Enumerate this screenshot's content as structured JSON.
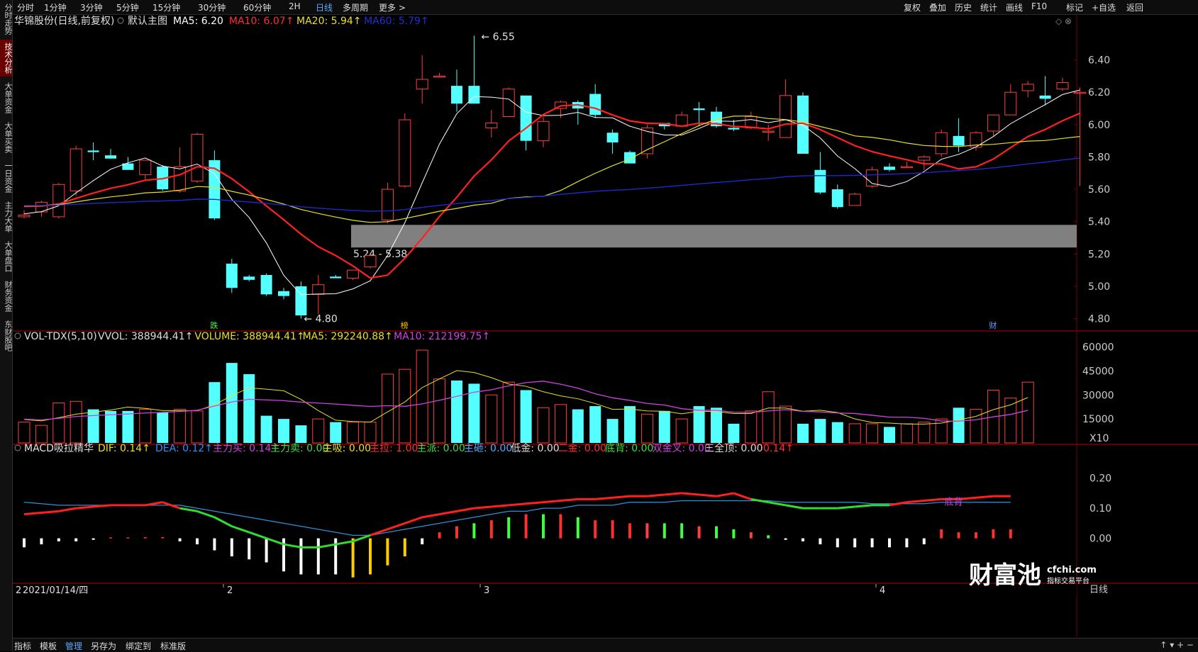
{
  "sidebar": {
    "tabs": [
      "分时走势",
      "技术分析",
      "大单资金",
      "大单买卖",
      "一日资金",
      "主力大单",
      "大单盘口",
      "财务资金",
      "东财股吧"
    ],
    "active_index": 1
  },
  "topbar": {
    "periods": [
      "分时",
      "1分钟",
      "3分钟",
      "5分钟",
      "15分钟",
      "30分钟",
      "60分钟",
      "2H",
      "日线",
      "多周期",
      "更多 >"
    ],
    "active_period": "日线",
    "right_items": [
      "复权",
      "叠加",
      "历史",
      "统计",
      "画线",
      "F10",
      "标记",
      "+自选",
      "返回"
    ]
  },
  "main": {
    "title": "华锦股份(日线,前复权)",
    "subtitle": "默认主图",
    "ma": [
      {
        "label": "MA5: 6.20",
        "color": "#ffffff"
      },
      {
        "label": "MA10: 6.07↑",
        "color": "#ff3030"
      },
      {
        "label": "MA20: 5.94↑",
        "color": "#e8e020"
      },
      {
        "label": "MA60: 5.79↑",
        "color": "#2030d0"
      }
    ],
    "price_axis": [
      "6.40",
      "6.20",
      "6.00",
      "5.80",
      "5.60",
      "5.40",
      "5.20",
      "5.00",
      "4.80"
    ],
    "high_label": "6.55",
    "low_label": "4.80",
    "zone_label": "5.24 - 5.38",
    "markers": [
      {
        "text": "跌",
        "color": "#40ff40"
      },
      {
        "text": "榜",
        "color": "#ffcc00"
      },
      {
        "text": "财",
        "color": "#60a0ff"
      }
    ]
  },
  "volume": {
    "title": "VOL-TDX(5,10)",
    "items": [
      {
        "label": "VVOL: 388944.41↑",
        "color": "#dddddd"
      },
      {
        "label": "VOLUME: 388944.41↑",
        "color": "#e8e020"
      },
      {
        "label": "MA5: 292240.88↑",
        "color": "#e8e020"
      },
      {
        "label": "MA10: 212199.75↑",
        "color": "#cc44dd"
      }
    ],
    "axis": [
      "60000",
      "45000",
      "30000",
      "15000",
      "X10"
    ]
  },
  "macd": {
    "title": "MACD吸拉精华",
    "items": [
      {
        "label": "DIF: 0.14↑",
        "color": "#e8e020"
      },
      {
        "label": "DEA: 0.12↑",
        "color": "#3090ff"
      },
      {
        "label": "主力买: 0.14↑",
        "color": "#cc44dd"
      },
      {
        "label": "主力卖: 0.00",
        "color": "#40dd40"
      },
      {
        "label": "主吸: 0.00",
        "color": "#e8e020"
      },
      {
        "label": "主拉: 1.00",
        "color": "#ff3030"
      },
      {
        "label": "主派: 0.00",
        "color": "#40dd40"
      },
      {
        "label": "主砸: 0.00",
        "color": "#5aa9ff"
      },
      {
        "label": "低金: 0.00",
        "color": "#dddddd"
      },
      {
        "label": "二金: 0.00",
        "color": "#ff3030"
      },
      {
        "label": "底背: 0.00",
        "color": "#40dd40"
      },
      {
        "label": "双金叉: 0.00",
        "color": "#cc44dd"
      },
      {
        "label": "三全顶: 0.00",
        "color": "#dddddd"
      },
      {
        "label": ": 0.14↑",
        "color": "#ff3030"
      }
    ],
    "axis": [
      "0.20",
      "0.10",
      "0.00"
    ],
    "divergence_label": "底背"
  },
  "xaxis": {
    "date": "2021/01/14/四",
    "prefix": "2",
    "months": [
      "2",
      "3",
      "4"
    ],
    "right_label": "日线"
  },
  "watermark": {
    "brand": "财富池",
    "domain": "cfchi.com",
    "tagline": "指标交易平台"
  },
  "bottombar": {
    "items": [
      "指标",
      "模板",
      "管理",
      "另存为",
      "绑定到",
      "标准版"
    ],
    "active": "管理"
  },
  "chart_data": {
    "type": "candlestick",
    "title": "华锦股份(日线,前复权)",
    "ylim": [
      4.75,
      6.6
    ],
    "candles": [
      {
        "o": 5.43,
        "h": 5.47,
        "l": 5.42,
        "c": 5.44
      },
      {
        "o": 5.46,
        "h": 5.53,
        "l": 5.43,
        "c": 5.52
      },
      {
        "o": 5.43,
        "h": 5.64,
        "l": 5.42,
        "c": 5.63
      },
      {
        "o": 5.59,
        "h": 5.87,
        "l": 5.56,
        "c": 5.85
      },
      {
        "o": 5.84,
        "h": 5.89,
        "l": 5.78,
        "c": 5.83
      },
      {
        "o": 5.81,
        "h": 5.85,
        "l": 5.79,
        "c": 5.79
      },
      {
        "o": 5.76,
        "h": 5.8,
        "l": 5.72,
        "c": 5.72
      },
      {
        "o": 5.69,
        "h": 5.78,
        "l": 5.66,
        "c": 5.78
      },
      {
        "o": 5.74,
        "h": 5.75,
        "l": 5.59,
        "c": 5.6
      },
      {
        "o": 5.59,
        "h": 5.86,
        "l": 5.58,
        "c": 5.74
      },
      {
        "o": 5.65,
        "h": 5.95,
        "l": 5.64,
        "c": 5.94
      },
      {
        "o": 5.78,
        "h": 5.84,
        "l": 5.41,
        "c": 5.42
      },
      {
        "o": 5.14,
        "h": 5.17,
        "l": 4.96,
        "c": 4.99
      },
      {
        "o": 5.06,
        "h": 5.07,
        "l": 5.03,
        "c": 5.04
      },
      {
        "o": 5.07,
        "h": 5.08,
        "l": 4.94,
        "c": 4.95
      },
      {
        "o": 4.97,
        "h": 4.99,
        "l": 4.92,
        "c": 4.94
      },
      {
        "o": 5.0,
        "h": 5.03,
        "l": 4.8,
        "c": 4.82
      },
      {
        "o": 4.95,
        "h": 5.07,
        "l": 4.83,
        "c": 5.01
      },
      {
        "o": 5.06,
        "h": 5.07,
        "l": 5.05,
        "c": 5.05
      },
      {
        "o": 5.05,
        "h": 5.1,
        "l": 5.04,
        "c": 5.1
      },
      {
        "o": 5.12,
        "h": 5.2,
        "l": 5.11,
        "c": 5.19
      },
      {
        "o": 5.41,
        "h": 5.64,
        "l": 5.39,
        "c": 5.6
      },
      {
        "o": 5.62,
        "h": 6.07,
        "l": 5.61,
        "c": 6.03
      },
      {
        "o": 6.22,
        "h": 6.43,
        "l": 6.13,
        "c": 6.28
      },
      {
        "o": 6.3,
        "h": 6.32,
        "l": 6.29,
        "c": 6.3
      },
      {
        "o": 6.24,
        "h": 6.34,
        "l": 6.08,
        "c": 6.13
      },
      {
        "o": 6.24,
        "h": 6.55,
        "l": 6.13,
        "c": 6.13
      },
      {
        "o": 5.98,
        "h": 6.09,
        "l": 5.92,
        "c": 6.01
      },
      {
        "o": 6.05,
        "h": 6.23,
        "l": 6.05,
        "c": 6.22
      },
      {
        "o": 6.18,
        "h": 6.18,
        "l": 5.84,
        "c": 5.9
      },
      {
        "o": 5.9,
        "h": 6.05,
        "l": 5.86,
        "c": 6.02
      },
      {
        "o": 6.1,
        "h": 6.15,
        "l": 6.04,
        "c": 6.14
      },
      {
        "o": 6.14,
        "h": 6.15,
        "l": 6.0,
        "c": 6.1
      },
      {
        "o": 6.19,
        "h": 6.25,
        "l": 6.04,
        "c": 6.06
      },
      {
        "o": 5.95,
        "h": 5.97,
        "l": 5.82,
        "c": 5.89
      },
      {
        "o": 5.83,
        "h": 5.84,
        "l": 5.76,
        "c": 5.76
      },
      {
        "o": 5.82,
        "h": 6.0,
        "l": 5.79,
        "c": 5.98
      },
      {
        "o": 6.01,
        "h": 6.01,
        "l": 5.97,
        "c": 5.99
      },
      {
        "o": 5.99,
        "h": 6.08,
        "l": 5.99,
        "c": 6.06
      },
      {
        "o": 6.1,
        "h": 6.14,
        "l": 5.99,
        "c": 6.09
      },
      {
        "o": 6.08,
        "h": 6.11,
        "l": 5.98,
        "c": 5.99
      },
      {
        "o": 5.98,
        "h": 6.03,
        "l": 5.96,
        "c": 5.97
      },
      {
        "o": 5.98,
        "h": 6.08,
        "l": 5.97,
        "c": 6.05
      },
      {
        "o": 5.96,
        "h": 6.0,
        "l": 5.9,
        "c": 5.96
      },
      {
        "o": 5.92,
        "h": 6.28,
        "l": 5.92,
        "c": 6.18
      },
      {
        "o": 6.18,
        "h": 6.2,
        "l": 5.82,
        "c": 5.82
      },
      {
        "o": 5.72,
        "h": 5.83,
        "l": 5.57,
        "c": 5.58
      },
      {
        "o": 5.6,
        "h": 5.63,
        "l": 5.48,
        "c": 5.49
      },
      {
        "o": 5.5,
        "h": 5.58,
        "l": 5.5,
        "c": 5.57
      },
      {
        "o": 5.62,
        "h": 5.74,
        "l": 5.61,
        "c": 5.72
      },
      {
        "o": 5.74,
        "h": 5.76,
        "l": 5.71,
        "c": 5.72
      },
      {
        "o": 5.74,
        "h": 5.77,
        "l": 5.73,
        "c": 5.74
      },
      {
        "o": 5.78,
        "h": 5.81,
        "l": 5.72,
        "c": 5.8
      },
      {
        "o": 5.82,
        "h": 5.97,
        "l": 5.8,
        "c": 5.95
      },
      {
        "o": 5.93,
        "h": 6.04,
        "l": 5.83,
        "c": 5.87
      },
      {
        "o": 5.86,
        "h": 5.96,
        "l": 5.84,
        "c": 5.95
      },
      {
        "o": 5.96,
        "h": 6.06,
        "l": 5.93,
        "c": 6.06
      },
      {
        "o": 6.06,
        "h": 6.25,
        "l": 6.06,
        "c": 6.2
      },
      {
        "o": 6.21,
        "h": 6.27,
        "l": 6.17,
        "c": 6.25
      },
      {
        "o": 6.18,
        "h": 6.3,
        "l": 6.12,
        "c": 6.16
      },
      {
        "o": 6.22,
        "h": 6.29,
        "l": 6.21,
        "c": 6.26
      },
      {
        "o": 6.2,
        "h": 6.23,
        "l": 5.62,
        "c": 6.2
      }
    ],
    "volumes": [
      13,
      11,
      25,
      26,
      21,
      20,
      20,
      21,
      19,
      21,
      20,
      38,
      50,
      43,
      17,
      15,
      11,
      15,
      13,
      13,
      13,
      43,
      46,
      58,
      40,
      39,
      37,
      30,
      38,
      33,
      22,
      24,
      21,
      23,
      15,
      23,
      18,
      20,
      15,
      23,
      22,
      12,
      20,
      32,
      23,
      12,
      15,
      13,
      12,
      12,
      10,
      12,
      13,
      15,
      22,
      21,
      33,
      28,
      38
    ],
    "macd_hist": [
      -0.03,
      -0.02,
      -0.01,
      -0.01,
      -0.005,
      0.003,
      0.003,
      0.004,
      0.004,
      -0.01,
      -0.02,
      -0.04,
      -0.06,
      -0.07,
      -0.08,
      -0.11,
      -0.12,
      -0.12,
      -0.12,
      -0.13,
      -0.12,
      -0.09,
      -0.06,
      -0.02,
      0.02,
      0.04,
      0.05,
      0.06,
      0.07,
      0.08,
      0.08,
      0.08,
      0.07,
      0.06,
      0.06,
      0.05,
      0.05,
      0.05,
      0.05,
      0.04,
      0.04,
      0.03,
      0.02,
      0.01,
      -0.005,
      -0.01,
      -0.02,
      -0.03,
      -0.03,
      -0.03,
      -0.03,
      -0.03,
      -0.02,
      0.03,
      0.02,
      0.02,
      0.03,
      0.03
    ],
    "dif": [
      0.08,
      0.085,
      0.09,
      0.1,
      0.105,
      0.11,
      0.11,
      0.11,
      0.12,
      0.1,
      0.09,
      0.07,
      0.04,
      0.02,
      0.0,
      -0.02,
      -0.03,
      -0.03,
      -0.02,
      -0.01,
      0.01,
      0.03,
      0.05,
      0.07,
      0.08,
      0.09,
      0.1,
      0.105,
      0.11,
      0.115,
      0.12,
      0.125,
      0.13,
      0.13,
      0.135,
      0.14,
      0.14,
      0.145,
      0.15,
      0.145,
      0.14,
      0.15,
      0.13,
      0.12,
      0.11,
      0.1,
      0.1,
      0.1,
      0.105,
      0.11,
      0.11,
      0.12,
      0.125,
      0.13,
      0.13,
      0.135,
      0.14,
      0.14
    ],
    "dea": [
      0.12,
      0.115,
      0.11,
      0.11,
      0.11,
      0.11,
      0.11,
      0.11,
      0.11,
      0.11,
      0.1,
      0.09,
      0.08,
      0.07,
      0.06,
      0.05,
      0.04,
      0.03,
      0.02,
      0.01,
      0.01,
      0.02,
      0.03,
      0.04,
      0.05,
      0.06,
      0.07,
      0.08,
      0.09,
      0.09,
      0.1,
      0.1,
      0.11,
      0.11,
      0.11,
      0.12,
      0.12,
      0.12,
      0.125,
      0.125,
      0.125,
      0.125,
      0.125,
      0.125,
      0.12,
      0.12,
      0.12,
      0.12,
      0.12,
      0.115,
      0.115,
      0.115,
      0.115,
      0.12,
      0.12,
      0.12,
      0.12,
      0.12
    ]
  }
}
